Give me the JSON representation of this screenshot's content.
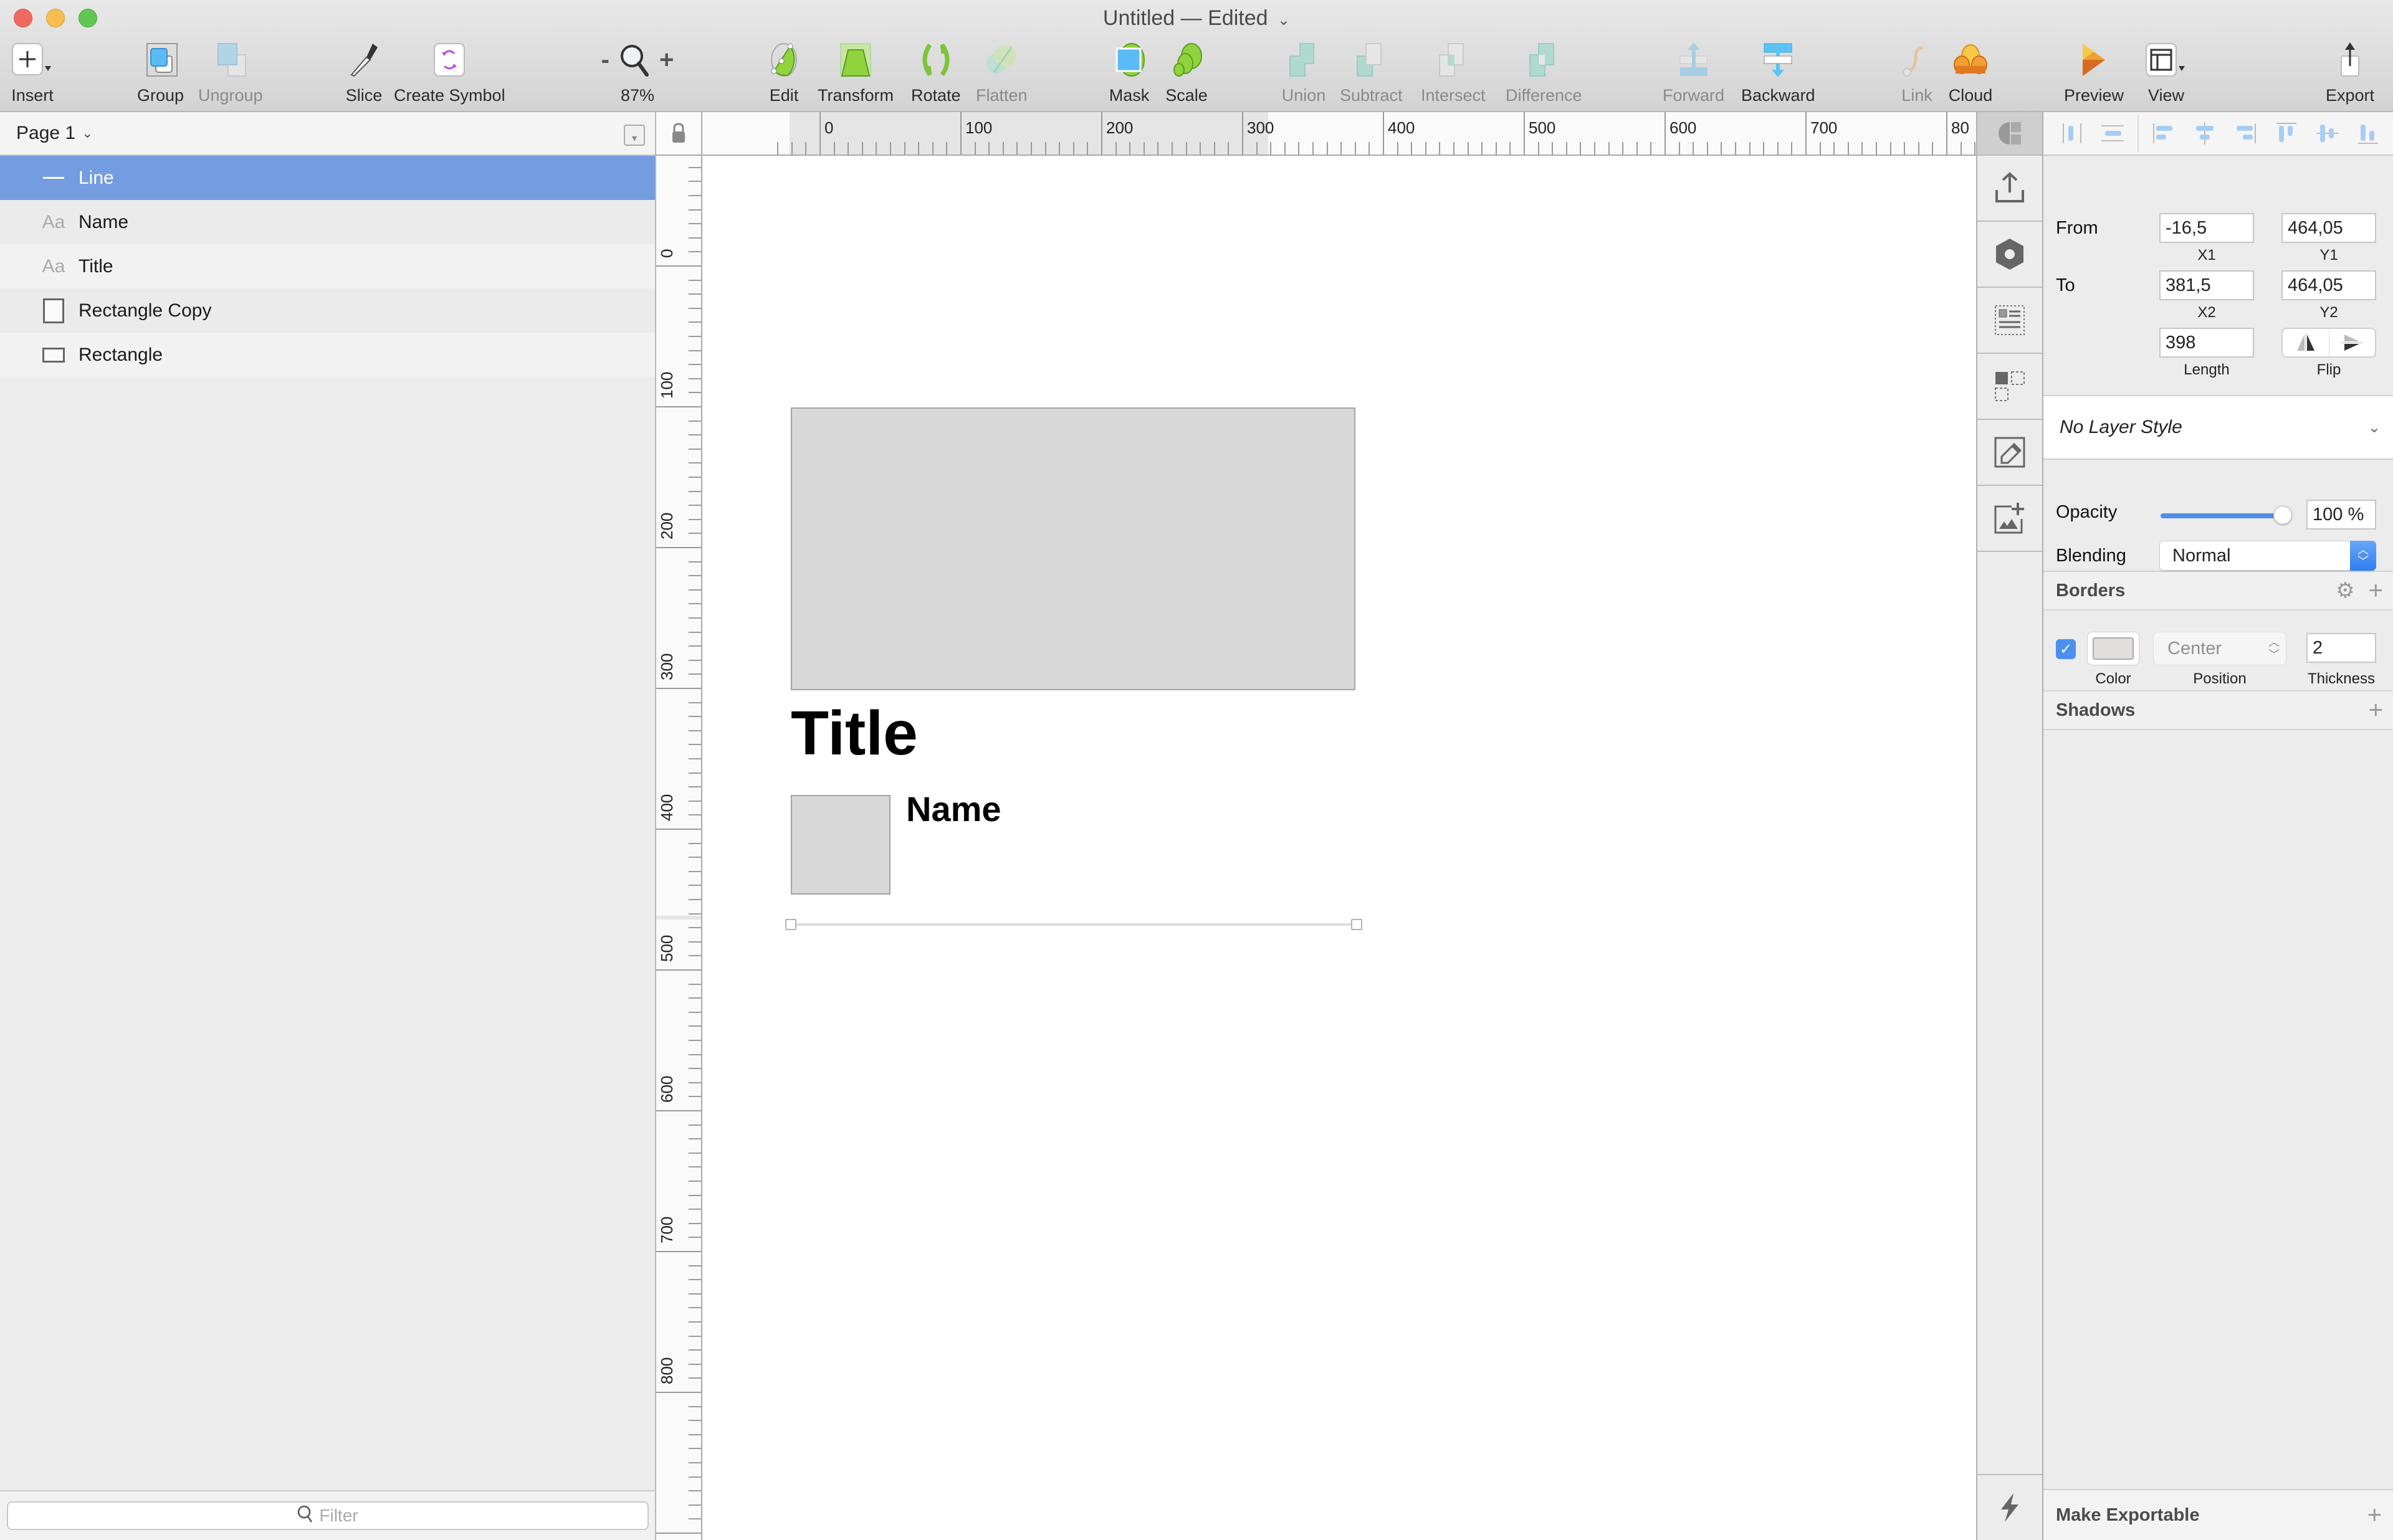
{
  "window": {
    "title": "Untitled",
    "separator": "—",
    "status": "Edited"
  },
  "toolbar": {
    "insert": "Insert",
    "group": "Group",
    "ungroup": "Ungroup",
    "slice": "Slice",
    "create_symbol": "Create Symbol",
    "zoom_minus": "-",
    "zoom_plus": "+",
    "zoom_level": "87%",
    "edit": "Edit",
    "transform": "Transform",
    "rotate": "Rotate",
    "flatten": "Flatten",
    "mask": "Mask",
    "scale": "Scale",
    "union": "Union",
    "subtract": "Subtract",
    "intersect": "Intersect",
    "difference": "Difference",
    "forward": "Forward",
    "backward": "Backward",
    "link": "Link",
    "cloud": "Cloud",
    "preview": "Preview",
    "view": "View",
    "export": "Export"
  },
  "layers_panel": {
    "page_name": "Page 1",
    "layers": [
      {
        "name": "Line",
        "icon": "line-icon",
        "selected": true
      },
      {
        "name": "Name",
        "icon": "text-icon",
        "selected": false
      },
      {
        "name": "Title",
        "icon": "text-icon",
        "selected": false
      },
      {
        "name": "Rectangle Copy",
        "icon": "rectangle-icon",
        "selected": false
      },
      {
        "name": "Rectangle",
        "icon": "rectangle-icon",
        "selected": false
      }
    ],
    "text_icon_glyph": "Aa",
    "filter_placeholder": "Filter"
  },
  "rulers": {
    "horizontal_labels": [
      "0",
      "100",
      "200",
      "300",
      "400",
      "500",
      "600",
      "700",
      "80"
    ],
    "vertical_labels": [
      "0",
      "100",
      "200",
      "300",
      "400",
      "500",
      "600",
      "700",
      "800"
    ]
  },
  "canvas": {
    "title_text": "Title",
    "name_text": "Name"
  },
  "inspector": {
    "from_label": "From",
    "to_label": "To",
    "x1": "-16,5",
    "y1": "464,05",
    "x2": "381,5",
    "y2": "464,05",
    "length": "398",
    "x1_label": "X1",
    "y1_label": "Y1",
    "x2_label": "X2",
    "y2_label": "Y2",
    "length_label": "Length",
    "flip_label": "Flip",
    "layer_style": "No Layer Style",
    "opacity_label": "Opacity",
    "opacity_value": "100 %",
    "opacity_fraction": 1.0,
    "blending_label": "Blending",
    "blending_value": "Normal",
    "borders_title": "Borders",
    "border_enabled": true,
    "border_color": "#e2dede",
    "border_position": "Center",
    "border_thickness": "2",
    "border_color_label": "Color",
    "border_position_label": "Position",
    "border_thickness_label": "Thickness",
    "shadows_title": "Shadows",
    "make_exportable": "Make Exportable"
  },
  "colors": {
    "selection": "#749ce0",
    "accent": "#4f8fe8",
    "shape_fill": "#d8d8d8"
  }
}
